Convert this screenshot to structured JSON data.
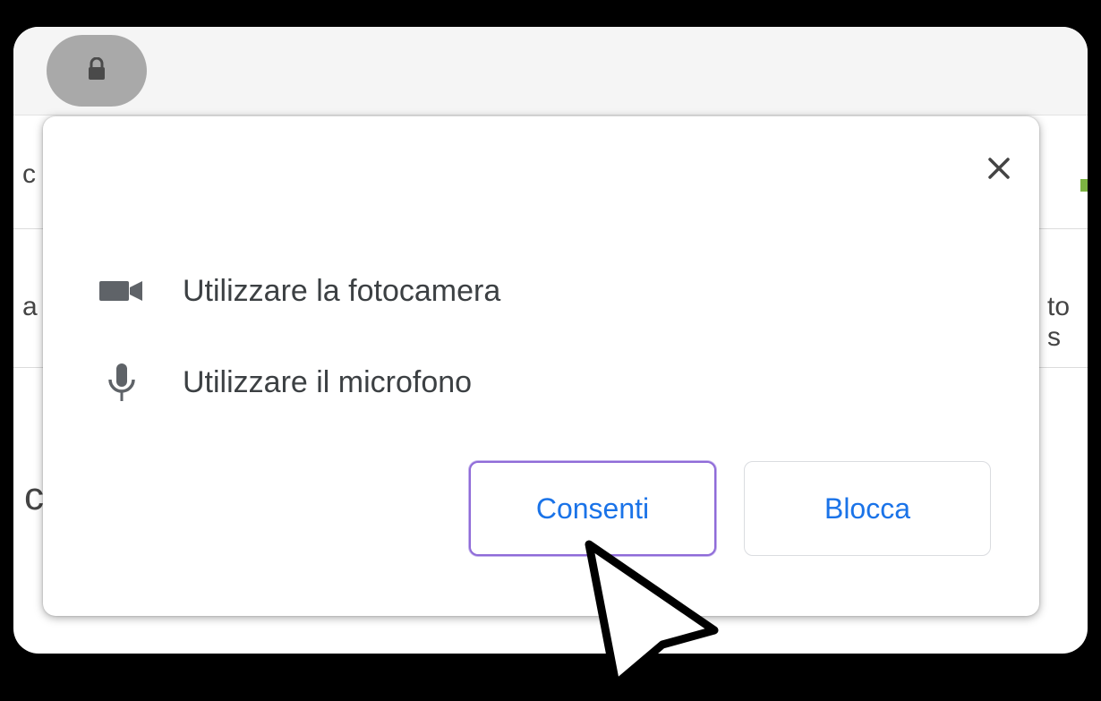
{
  "browser": {
    "site_info_icon": "lock-icon"
  },
  "background": {
    "fragment_left_1": "c",
    "fragment_left_2": "a",
    "fragment_left_3": "c",
    "fragment_right": "to s"
  },
  "popup": {
    "close_icon": "close-icon",
    "permissions": [
      {
        "icon": "video-camera-icon",
        "label": "Utilizzare la fotocamera"
      },
      {
        "icon": "microphone-icon",
        "label": "Utilizzare il microfono"
      }
    ],
    "allow_label": "Consenti",
    "block_label": "Blocca"
  },
  "colors": {
    "accent": "#1a73e8",
    "focus_ring": "#8f6bd8"
  }
}
